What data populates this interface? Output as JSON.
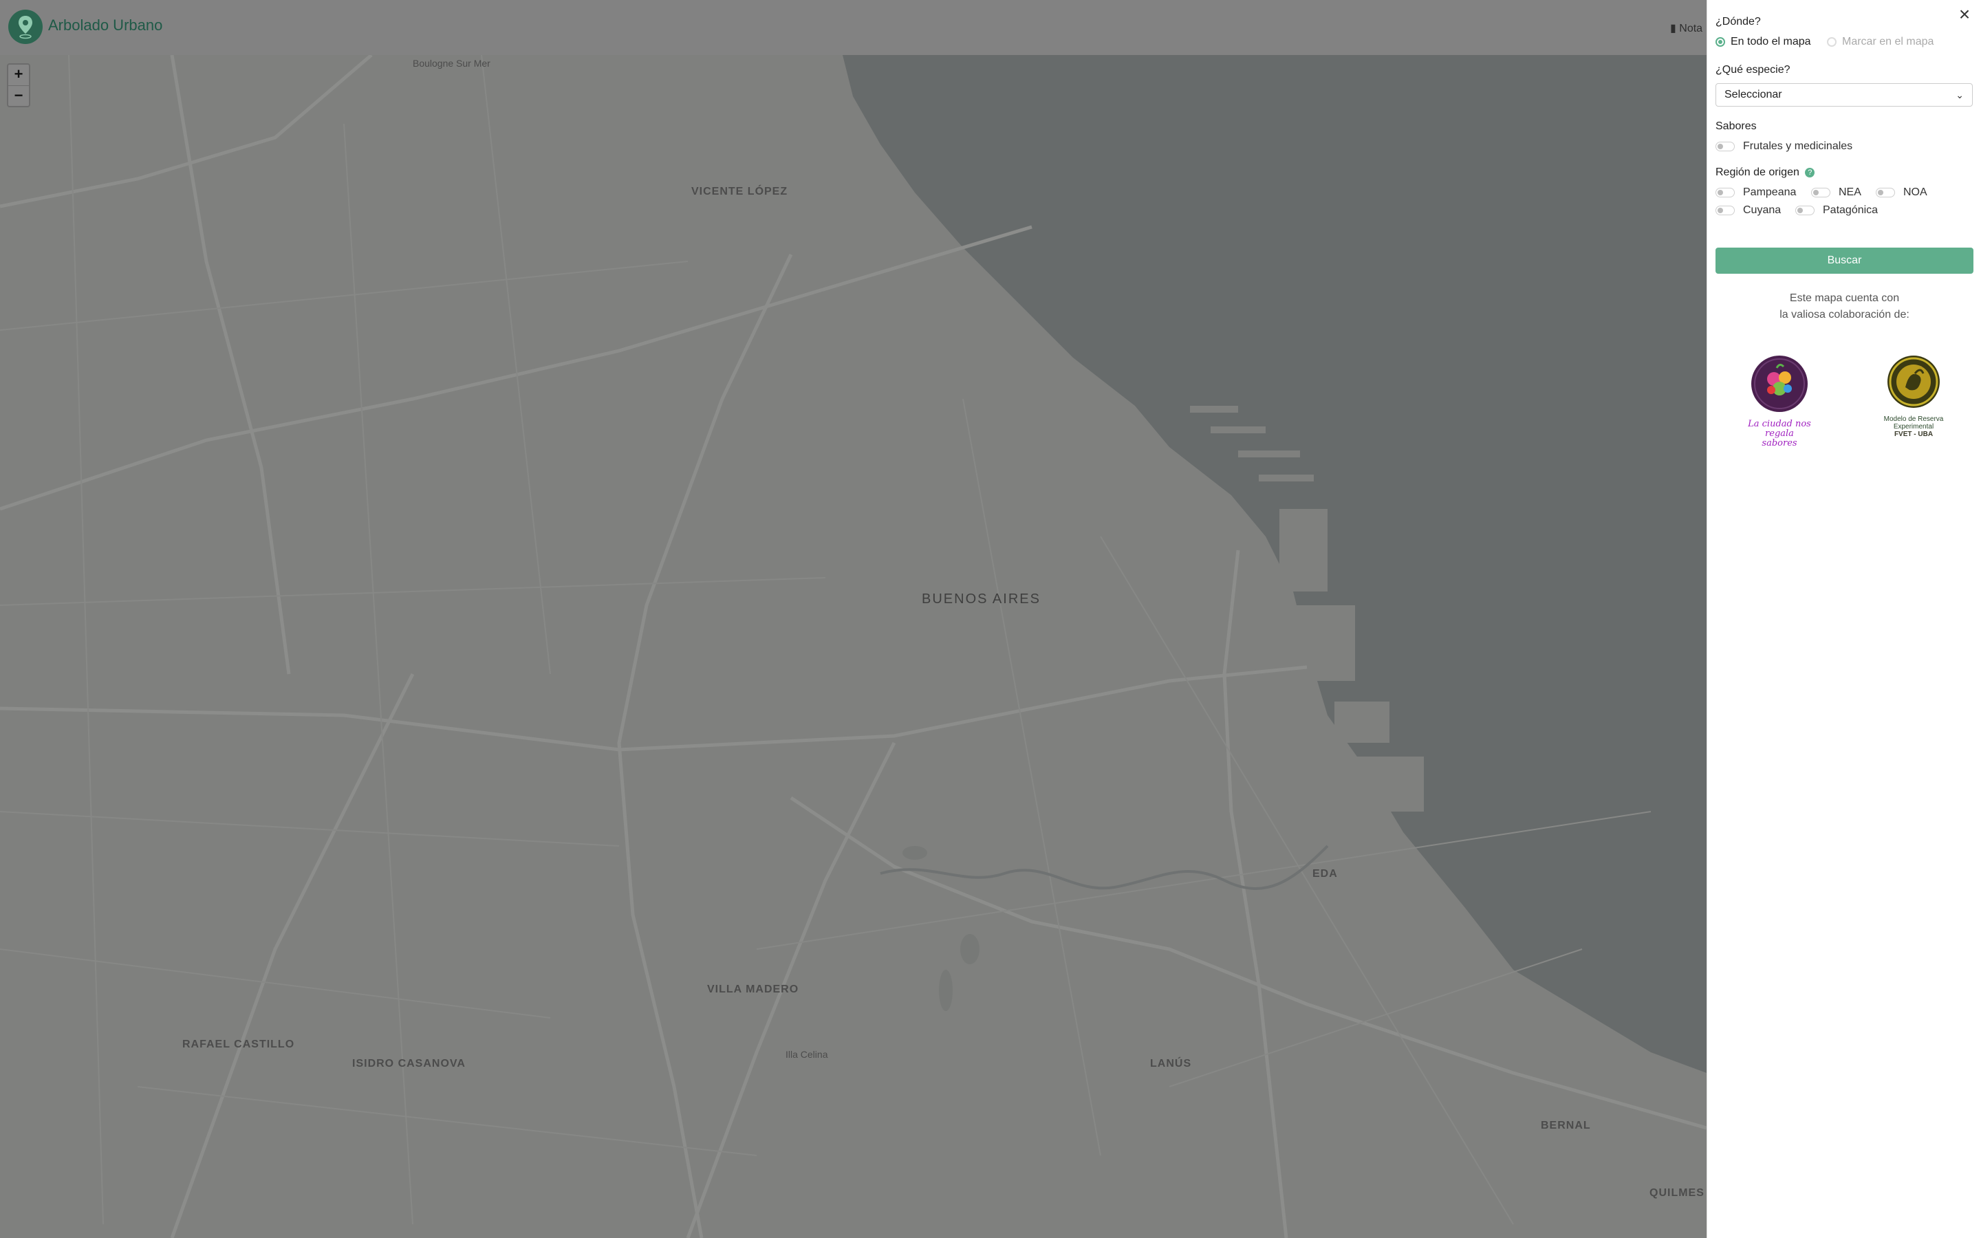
{
  "header": {
    "app_title": "Arbolado Urbano",
    "notas_label": "Nota"
  },
  "map": {
    "zoom_in": "+",
    "zoom_out": "−",
    "labels": {
      "boulogne": "Boulogne Sur Mer",
      "vicente_lopez": "VICENTE LÓPEZ",
      "buenos_aires": "BUENOS AIRES",
      "villa_madero": "VILLA MADERO",
      "rafael_castillo": "RAFAEL CASTILLO",
      "isidro_casanova": "ISIDRO CASANOVA",
      "illa_celina": "Illa Celina",
      "lanus": "LANÚS",
      "eda": "EDA",
      "bernal": "BERNAL",
      "quilmes": "QUILMES"
    }
  },
  "panel": {
    "close_symbol": "×",
    "donde_label": "¿Dónde?",
    "donde_options": [
      "En todo el mapa",
      "Marcar en el mapa"
    ],
    "especie_label": "¿Qué especie?",
    "especie_value": "Seleccionar",
    "sabores_label": "Sabores",
    "sabores_option": "Frutales y medicinales",
    "region_label": "Región de origen",
    "help_symbol": "?",
    "regions": [
      "Pampeana",
      "NEA",
      "NOA",
      "Cuyana",
      "Patagónica"
    ],
    "search_button": "Buscar",
    "collab_line1": "Este mapa cuenta con",
    "collab_line2": "la valiosa colaboración de:",
    "partner1_text": "La ciudad nos regala sabores",
    "partner2_line1": "Modelo de Reserva Experimental",
    "partner2_line2": "FVET - UBA"
  },
  "colors": {
    "accent": "#5fae8c",
    "brand_dark": "#2c6651",
    "water": "#676b6b",
    "land": "#7f807e"
  }
}
